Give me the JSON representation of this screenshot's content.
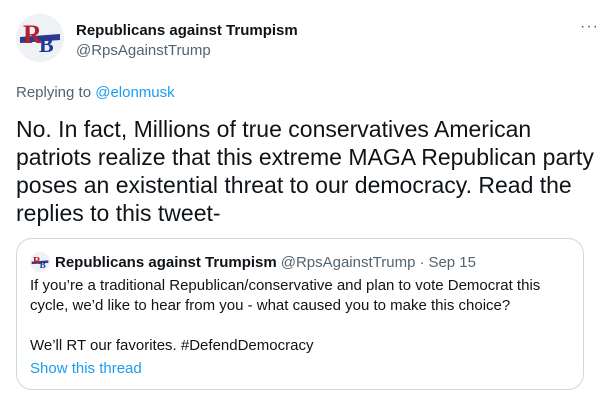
{
  "author": {
    "name": "Republicans against Trumpism",
    "handle": "@RpsAgainstTrump",
    "avatar_text": "RB"
  },
  "reply": {
    "prefix": "Replying to ",
    "mention": "@elonmusk"
  },
  "tweet_text": "No. In fact, Millions of true conservatives American patriots realize that this extreme MAGA Republican party poses an existential threat to our democracy. Read the replies to this tweet-",
  "more_icon": "···",
  "quote": {
    "name": "Republicans against Trumpism",
    "handle": "@RpsAgainstTrump",
    "dot": "·",
    "date": "Sep 15",
    "text": "If you’re a traditional Republican/conservative and plan to vote Democrat this cycle, we’d like to hear from you - what caused you to make this choice?\n\nWe’ll RT our favorites. #DefendDemocracy",
    "show_thread": "Show this thread"
  },
  "colors": {
    "link": "#1d9bf0",
    "secondary_text": "#536471",
    "border": "#cfd9de"
  }
}
